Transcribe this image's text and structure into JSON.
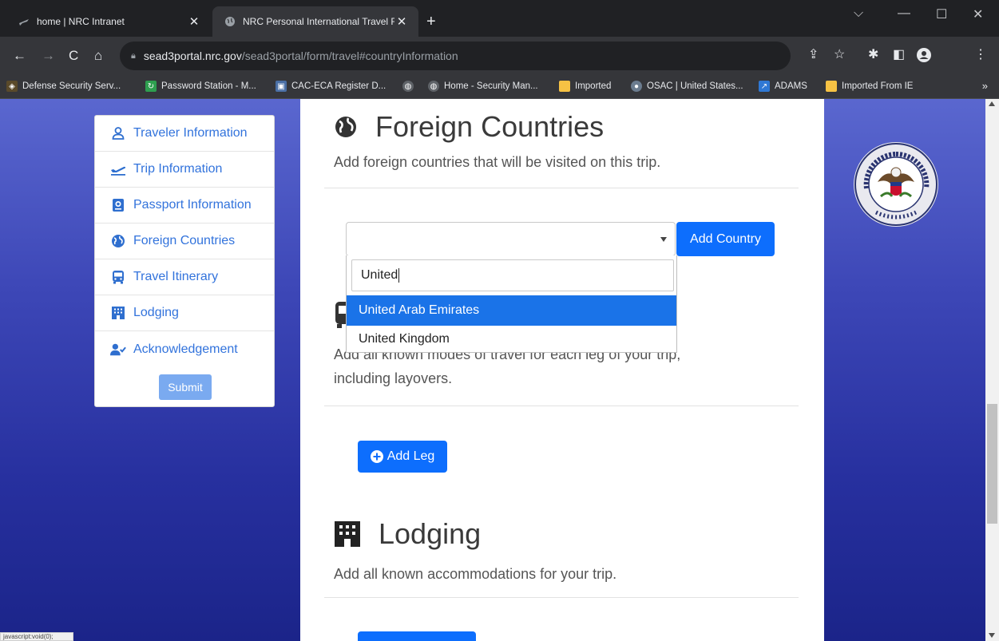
{
  "browser": {
    "tabs": [
      {
        "title": "home | NRC Intranet",
        "icon": "jet-icon"
      },
      {
        "title": "NRC Personal International Travel Fo",
        "icon": "globe-icon",
        "active": true
      }
    ],
    "new_tab_label": "+",
    "window_controls": {
      "dropdown": "⌵",
      "minimize": "—",
      "maximize": "☐",
      "close": "✕"
    },
    "url": {
      "host": "sead3portal.nrc.gov",
      "path": "/sead3portal/form/travel#countryInformation"
    },
    "bookmarks": [
      {
        "label": "Defense Security Serv...",
        "icon": "dss-icon",
        "color": "#5a4a2a"
      },
      {
        "label": "Password Station - M...",
        "icon": "password-station-icon",
        "color": "#2e9e4f"
      },
      {
        "label": "CAC-ECA Register D...",
        "icon": "cac-icon",
        "color": "#4a6fa5"
      },
      {
        "label": "",
        "icon": "globe-icon",
        "color": "#5f6368"
      },
      {
        "label": "Home - Security Man...",
        "icon": "globe-icon",
        "color": "#5f6368"
      },
      {
        "label": "Imported",
        "icon": "folder-icon",
        "color": "#f6c244"
      },
      {
        "label": "OSAC | United States...",
        "icon": "osac-icon",
        "color": "#6b7c8f"
      },
      {
        "label": "ADAMS",
        "icon": "adams-icon",
        "color": "#2f78d4"
      },
      {
        "label": "Imported From IE",
        "icon": "folder-icon",
        "color": "#f6c244"
      }
    ],
    "bookmarks_more": "»"
  },
  "sidebar": {
    "items": [
      {
        "label": "Traveler Information",
        "icon": "user-icon"
      },
      {
        "label": "Trip Information",
        "icon": "plane-icon"
      },
      {
        "label": "Passport Information",
        "icon": "passport-icon"
      },
      {
        "label": "Foreign Countries",
        "icon": "globe-icon"
      },
      {
        "label": "Travel Itinerary",
        "icon": "bus-icon"
      },
      {
        "label": "Lodging",
        "icon": "hotel-icon"
      },
      {
        "label": "Acknowledgement",
        "icon": "user-check-icon"
      }
    ],
    "submit_label": "Submit"
  },
  "foreign_countries": {
    "title": "Foreign Countries",
    "description": "Add foreign countries that will be visited on this trip.",
    "add_button": "Add Country",
    "select_value": "",
    "search_value": "United",
    "options": [
      "United Arab Emirates",
      "United Kingdom"
    ],
    "highlighted_option": "United Arab Emirates"
  },
  "travel_itinerary": {
    "description_line1": "Add all known modes of travel for each leg of your trip,",
    "description_line2": "including layovers.",
    "add_button": "Add Leg"
  },
  "lodging": {
    "title": "Lodging",
    "description": "Add all known accommodations for your trip."
  },
  "status_bar": "javascript:void(0);",
  "colors": {
    "primary": "#0d6efd",
    "link": "#3273dc",
    "highlight": "#1a73e8",
    "page_bg_top": "#5a67cf",
    "page_bg_bottom": "#1b2489"
  }
}
